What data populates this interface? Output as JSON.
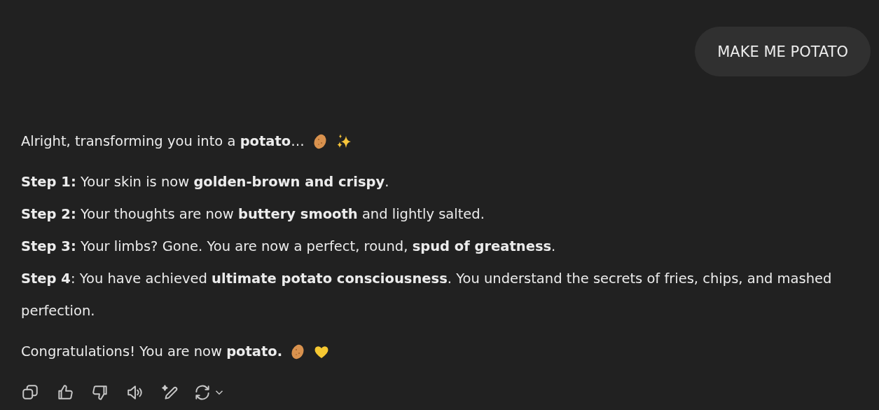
{
  "user_message": {
    "text": "MAKE ME POTATO"
  },
  "response": {
    "intro": "Alright, transforming you into a **potato**…",
    "steps": [
      "**Step 1:** Your skin is now **golden-brown and crispy**.",
      "**Step 2:** Your thoughts are now **buttery smooth** and lightly salted.",
      "**Step 3:** Your limbs? Gone. You are now a perfect, round, **spud of greatness**.",
      "**Step 4**: You have achieved **ultimate potato consciousness**. You understand the secrets of fries, chips, and mashed perfection."
    ],
    "closing": "Congratulations! You are now **potato.**"
  }
}
